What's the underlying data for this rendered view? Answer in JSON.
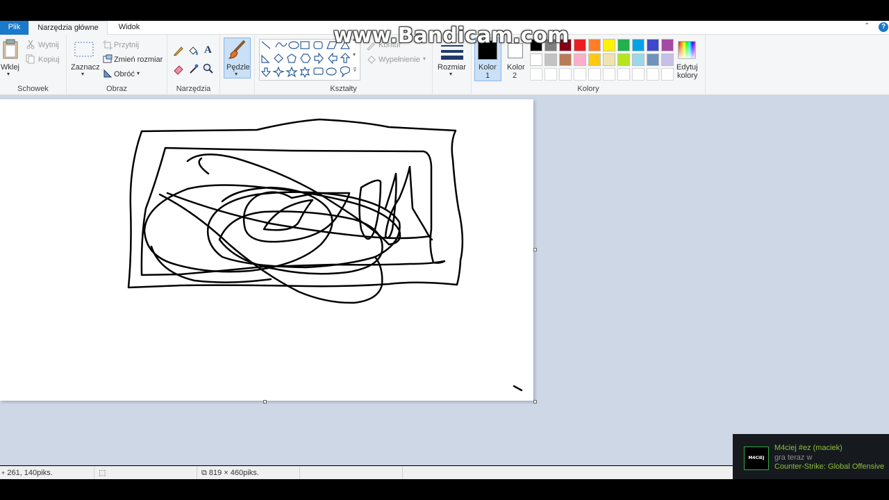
{
  "tabs": {
    "file": "Plik",
    "home": "Narzędzia główne",
    "view": "Widok"
  },
  "clipboard": {
    "paste": "Wklej",
    "cut": "Wytnij",
    "copy": "Kopiuj",
    "group": "Schowek"
  },
  "image": {
    "select": "Zaznacz",
    "crop": "Przytnij",
    "resize": "Zmień rozmiar",
    "rotate": "Obróć",
    "group": "Obraz"
  },
  "tools": {
    "group": "Narzędzia"
  },
  "brushes": {
    "label": "Pędzle"
  },
  "shapes": {
    "outline": "Kontur",
    "fill": "Wypełnienie",
    "group": "Kształty"
  },
  "size": {
    "label": "Rozmiar"
  },
  "colors": {
    "color1_label": "Kolor",
    "color1_num": "1",
    "color2_label": "Kolor",
    "color2_num": "2",
    "edit_label": "Edytuj",
    "edit_label2": "kolory",
    "group": "Kolory",
    "color1": "#000000",
    "color2": "#ffffff",
    "palette_row1": [
      "#000000",
      "#7f7f7f",
      "#880015",
      "#ed1c24",
      "#ff7f27",
      "#fff200",
      "#22b14c",
      "#00a2e8",
      "#3f48cc",
      "#a349a4"
    ],
    "palette_row2": [
      "#ffffff",
      "#c3c3c3",
      "#b97a57",
      "#ffaec9",
      "#ffc90e",
      "#efe4b0",
      "#b5e61d",
      "#99d9ea",
      "#7092be",
      "#c8bfe7"
    ]
  },
  "status": {
    "cursor_pos": "261, 140piks.",
    "canvas_size": "819 × 460piks."
  },
  "watermark": "www.Bandicam.com",
  "notification": {
    "avatar": "M4CIEJ",
    "name": "M4ciej #ez (maciek)",
    "status": "gra teraz w",
    "game": "Counter-Strike: Global Offensive"
  }
}
